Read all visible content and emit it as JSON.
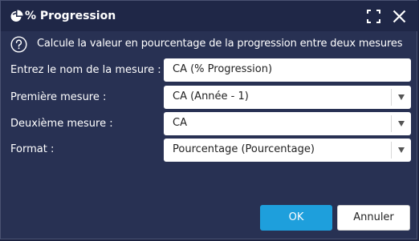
{
  "dialog": {
    "title": "% Progression",
    "title_icon": "pie-chart-icon",
    "maximize_icon": "maximize-icon",
    "close_icon": "close-icon"
  },
  "info": {
    "icon": "question-circle-icon",
    "text": "Calcule la valeur en pourcentage de la progression entre deux mesures"
  },
  "form": {
    "name_label": "Entrez le nom de la mesure :",
    "name_value": "CA (% Progression)",
    "first_label": "Première mesure :",
    "first_value": "CA (Année - 1)",
    "second_label": "Deuxième mesure :",
    "second_value": "CA",
    "format_label": "Format :",
    "format_value": "Pourcentage (Pourcentage)"
  },
  "buttons": {
    "ok_label": "OK",
    "cancel_label": "Annuler"
  },
  "colors": {
    "background": "#283153",
    "titlebar": "#1f2747",
    "primary": "#1e9fdc"
  }
}
